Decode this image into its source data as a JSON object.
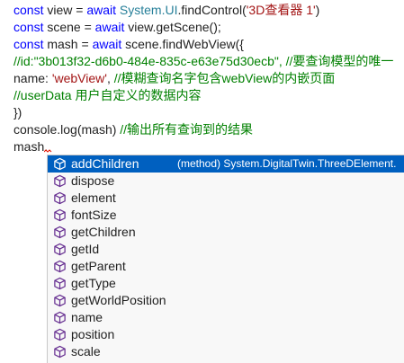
{
  "code": {
    "l1_kw1": "const",
    "l1_a": " view = ",
    "l1_kw2": "await",
    "l1_sp": " ",
    "l1_ty": "System.UI",
    "l1_b": ".findControl(",
    "l1_str": "'3D查看器 1'",
    "l1_c": ")",
    "l2_kw1": "const",
    "l2_a": " scene = ",
    "l2_kw2": "await",
    "l2_b": " view.getScene();",
    "l3_kw1": "const",
    "l3_a": " mash = ",
    "l3_kw2": "await",
    "l3_b": " scene.findWebView({",
    "l4_cm": "//id:\"3b013f32-d6b0-484e-835c-e63e75d30ecb\", //要查询模型的唯一",
    "l5_a": "name: ",
    "l5_str": "'webView'",
    "l5_b": ", ",
    "l5_cm": "//模糊查询名字包含webView的内嵌页面",
    "l6_cm": "//userData  用户自定义的数据内容",
    "l7": "})",
    "l8_a": "console.log(mash) ",
    "l8_cm": "//输出所有查询到的结果",
    "l9": "mash."
  },
  "suggest": {
    "selected_detail": "(method) System.DigitalTwin.ThreeDElement.",
    "items": [
      {
        "label": "addChildren",
        "icon": "cube-icon"
      },
      {
        "label": "dispose",
        "icon": "cube-icon"
      },
      {
        "label": "element",
        "icon": "cube-icon"
      },
      {
        "label": "fontSize",
        "icon": "cube-icon"
      },
      {
        "label": "getChildren",
        "icon": "cube-icon"
      },
      {
        "label": "getId",
        "icon": "cube-icon"
      },
      {
        "label": "getParent",
        "icon": "cube-icon"
      },
      {
        "label": "getType",
        "icon": "cube-icon"
      },
      {
        "label": "getWorldPosition",
        "icon": "cube-icon"
      },
      {
        "label": "name",
        "icon": "cube-icon"
      },
      {
        "label": "position",
        "icon": "cube-icon"
      },
      {
        "label": "scale",
        "icon": "cube-icon"
      }
    ]
  },
  "colors": {
    "keyword": "#0000ff",
    "type": "#267f99",
    "string": "#a31515",
    "comment": "#008000",
    "selection": "#0060c0",
    "icon": "#652d90"
  }
}
